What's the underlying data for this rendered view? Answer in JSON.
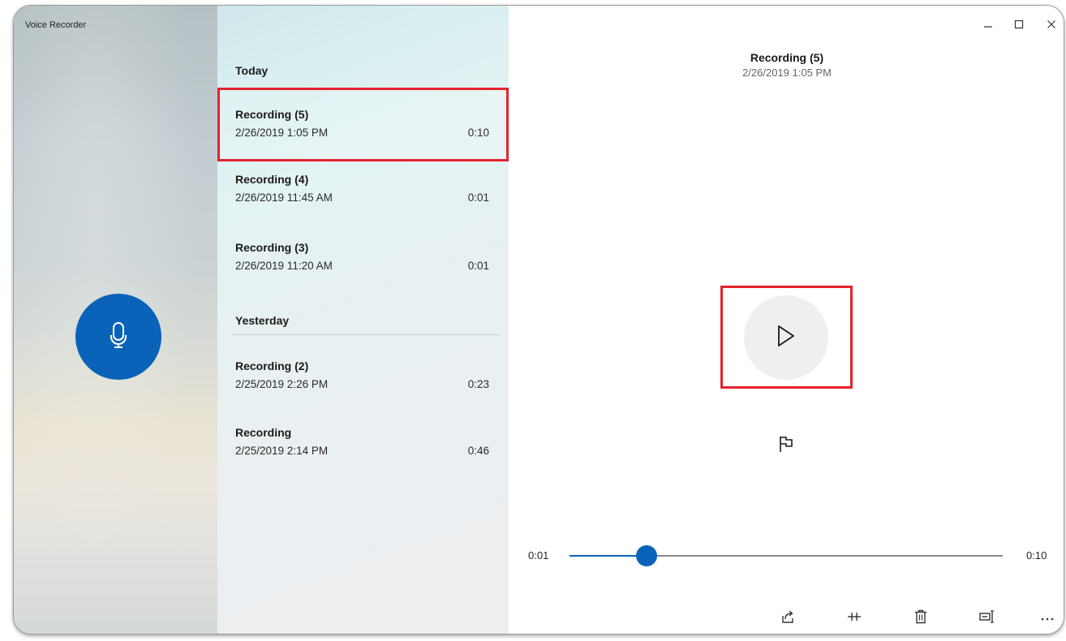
{
  "app": {
    "title": "Voice Recorder"
  },
  "list": {
    "groups": [
      {
        "label": "Today",
        "items": [
          {
            "name": "Recording (5)",
            "date": "2/26/2019 1:05 PM",
            "duration": "0:10",
            "selected": true
          },
          {
            "name": "Recording (4)",
            "date": "2/26/2019 11:45 AM",
            "duration": "0:01",
            "selected": false
          },
          {
            "name": "Recording (3)",
            "date": "2/26/2019 11:20 AM",
            "duration": "0:01",
            "selected": false
          }
        ]
      },
      {
        "label": "Yesterday",
        "items": [
          {
            "name": "Recording (2)",
            "date": "2/25/2019 2:26 PM",
            "duration": "0:23",
            "selected": false
          },
          {
            "name": "Recording",
            "date": "2/25/2019 2:14 PM",
            "duration": "0:46",
            "selected": false
          }
        ]
      }
    ]
  },
  "player": {
    "title": "Recording (5)",
    "date": "2/26/2019 1:05 PM",
    "current_time": "0:01",
    "total_time": "0:10",
    "progress_fraction": 0.177
  },
  "icons": {
    "record": "microphone-icon",
    "play": "play-icon",
    "marker": "flag-icon",
    "share": "share-icon",
    "trim": "trim-icon",
    "delete": "delete-icon",
    "rename": "rename-icon",
    "more": "more-icon",
    "minimize": "minimize-icon",
    "maximize": "maximize-icon",
    "close": "close-icon"
  },
  "colors": {
    "accent": "#0a63b8",
    "highlight": "#e5232d"
  }
}
